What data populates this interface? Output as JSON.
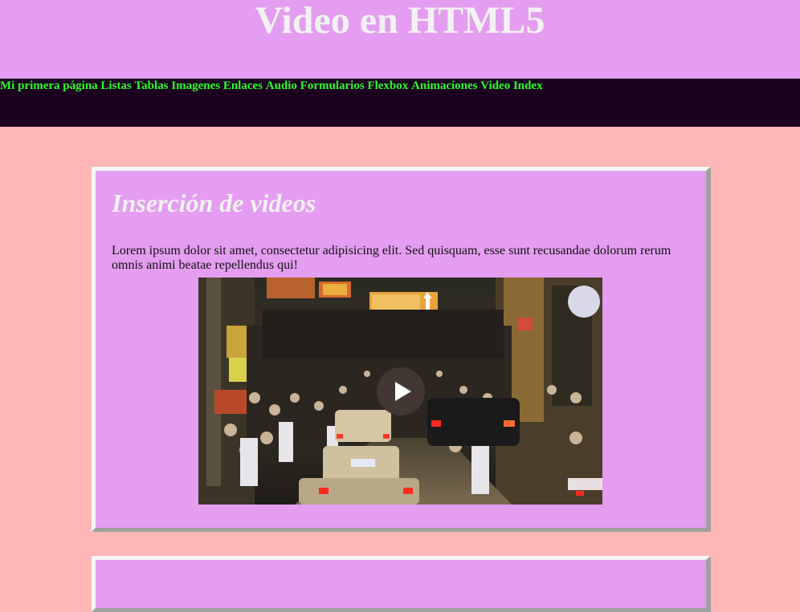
{
  "header": {
    "title": "Video en HTML5"
  },
  "nav": {
    "items": [
      {
        "label": "Mi primera página"
      },
      {
        "label": "Listas"
      },
      {
        "label": "Tablas"
      },
      {
        "label": "Imagenes"
      },
      {
        "label": "Enlaces"
      },
      {
        "label": "Audio"
      },
      {
        "label": "Formularios"
      },
      {
        "label": "Flexbox"
      },
      {
        "label": "Animaciones"
      },
      {
        "label": "Video"
      },
      {
        "label": "Index"
      }
    ]
  },
  "sections": [
    {
      "title": "Inserción de videos",
      "text": "Lorem ipsum dolor sit amet, consectetur adipisicing elit. Sed quisquam, esse sunt recusandae dolorum rerum omnis animi beatae repellendus qui!",
      "video": {
        "content": "night city street crowd with taxis",
        "play_icon": "play-icon"
      }
    }
  ],
  "colors": {
    "page_background": "#ffb6b6",
    "header_background": "#e49df0",
    "nav_background": "#1b0020",
    "nav_link": "#27ff27",
    "card_background": "#e49df0",
    "heading_text": "#f2f2f2"
  }
}
